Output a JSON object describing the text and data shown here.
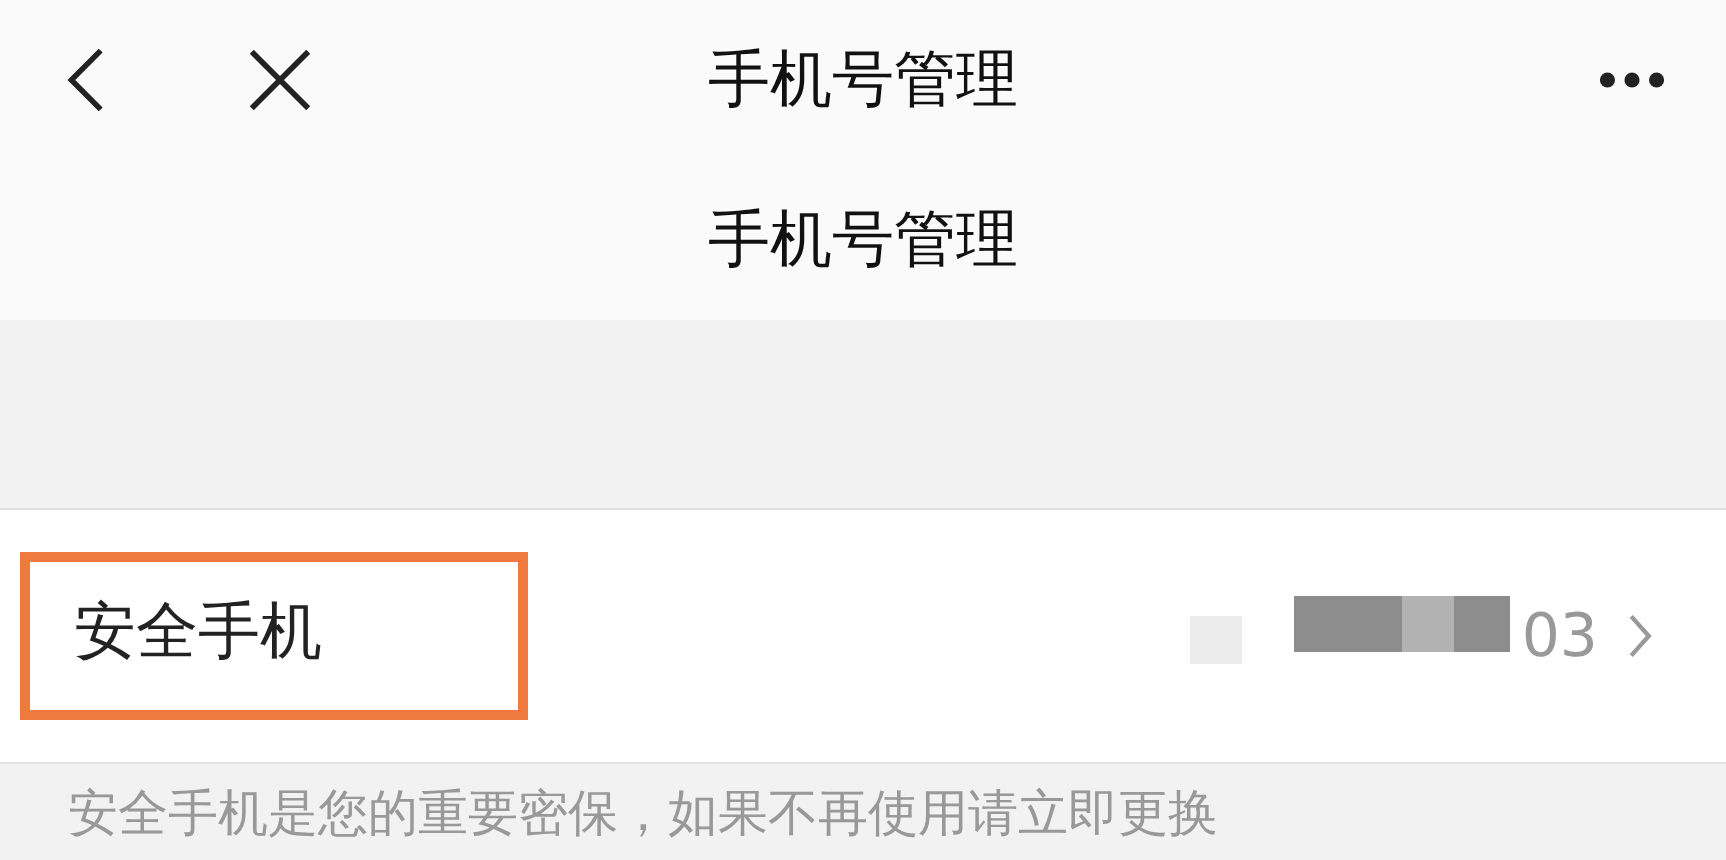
{
  "nav_bar": {
    "title": "手机号管理"
  },
  "page_heading": "手机号管理",
  "security_phone": {
    "label": "安全手机",
    "highlighted": true,
    "number_suffix": "03"
  },
  "footnote": "安全手机是您的重要密保，如果不再使用请立即更换"
}
